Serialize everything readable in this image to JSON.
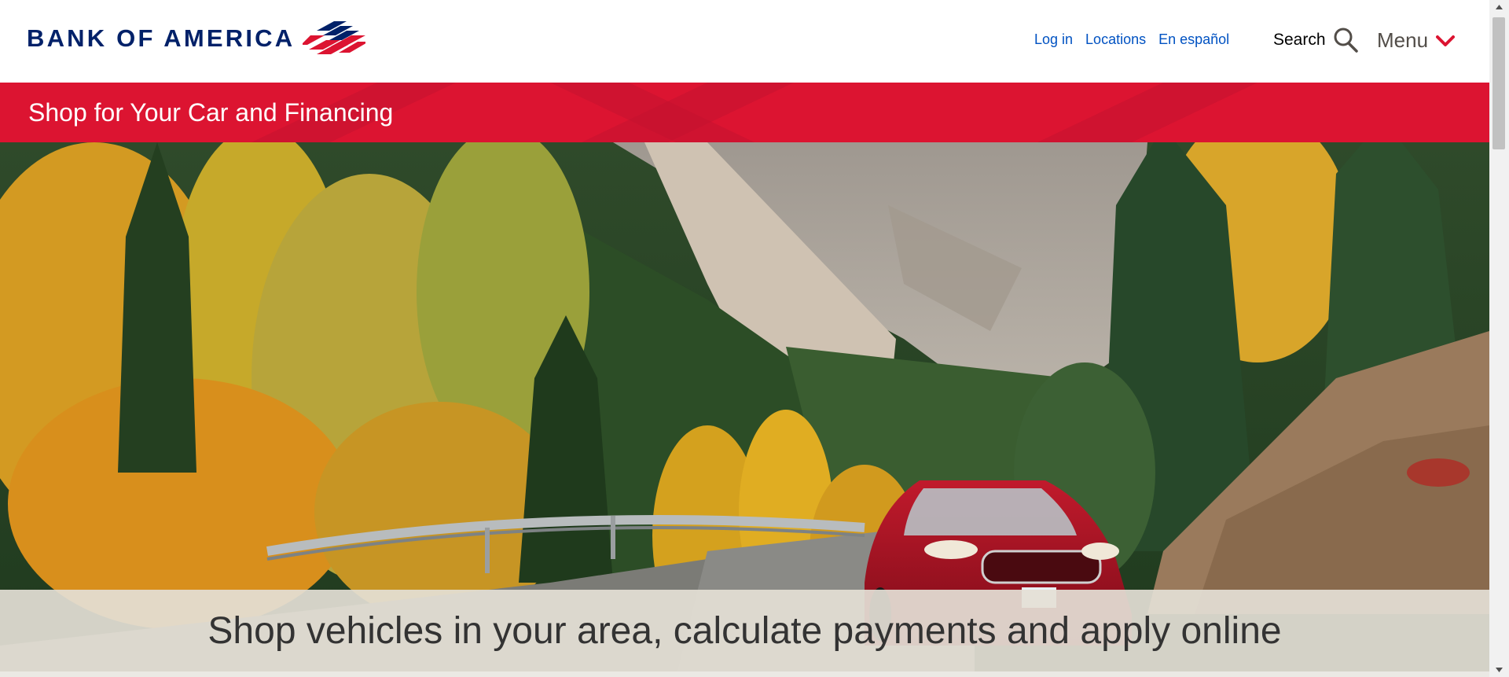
{
  "header": {
    "logo_text": "BANK OF AMERICA",
    "links": [
      {
        "label": "Log in"
      },
      {
        "label": "Locations"
      },
      {
        "label": "En español"
      }
    ],
    "search_label": "Search",
    "menu_label": "Menu"
  },
  "banner": {
    "title": "Shop for Your Car and Financing"
  },
  "hero": {
    "tagline": "Shop vehicles in your area, calculate payments and apply online"
  },
  "colors": {
    "brand_red": "#dc1431",
    "brand_navy": "#012169",
    "link_blue": "#0052c2"
  },
  "icons": {
    "search": "search-icon",
    "menu_chevron": "chevron-down-icon",
    "logo_flag": "flag-logo-icon"
  }
}
